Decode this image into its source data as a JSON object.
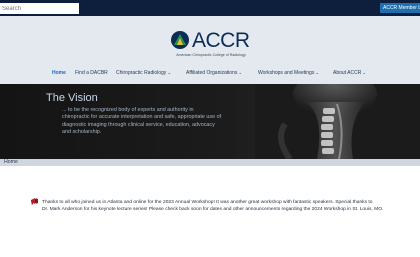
{
  "topbar": {
    "search_placeholder": "Search",
    "member_button": "ACCR Member L"
  },
  "logo": {
    "name": "ACCR",
    "subtitle": "American Chiropractic College of Radiology"
  },
  "nav": {
    "items": [
      {
        "label": "Home",
        "active": true,
        "dropdown": false
      },
      {
        "label": "Find a DACBR",
        "active": false,
        "dropdown": false
      },
      {
        "label": "Chiropractic Radiology",
        "active": false,
        "dropdown": true
      },
      {
        "label": "Affiliated Organizations",
        "active": false,
        "dropdown": true
      },
      {
        "label": "Workshops and Meetings",
        "active": false,
        "dropdown": true
      },
      {
        "label": "About ACCR",
        "active": false,
        "dropdown": true
      }
    ]
  },
  "hero": {
    "title": "The Vision",
    "text": "... to be the recognized body of experts and authority in chiropractic for accurate interpretation and safe, appropriate use of diagnostic imaging through clinical service, education, advocacy and scholarship."
  },
  "breadcrumb": "Home",
  "announcement": {
    "line1": "Thanks to all who joined us in Atlanta and online for the 2023 Annual Workshop! It was another great workshop with fantastic speakers. Special thanks to",
    "line2": "Dr. Mark Anderson for his keynote lecture series! Please check back soon for dates and other announcements regarding the 2024 Workshop in St. Louis, MO."
  },
  "colors": {
    "topbar": "#0d1f3c",
    "header_bg": "#e4e9f0",
    "nav_active": "#1a67b8",
    "hero_bg": "#1a1a1a",
    "logo_text": "#0b2c55"
  }
}
